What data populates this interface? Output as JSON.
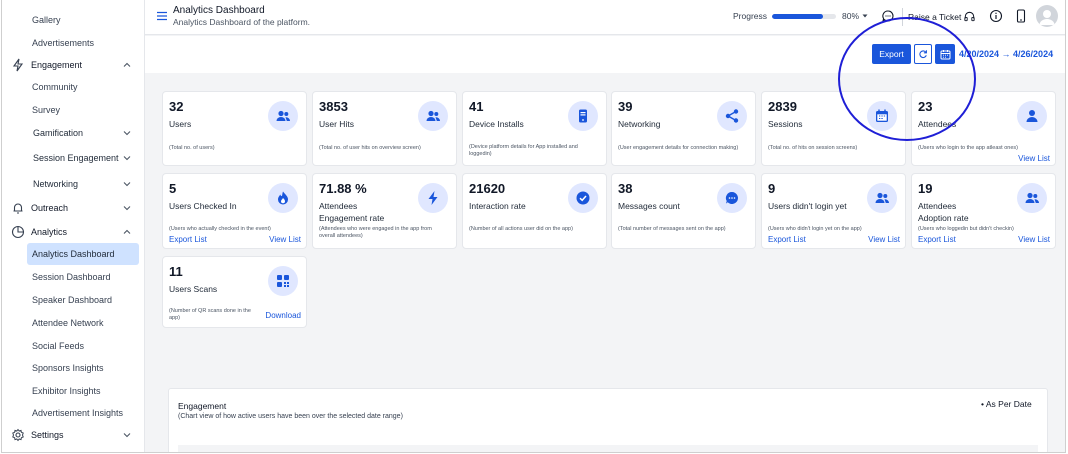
{
  "sidebar": {
    "items": [
      {
        "label": "Gallery",
        "kind": "sub"
      },
      {
        "label": "Advertisements",
        "kind": "sub"
      },
      {
        "label": "Engagement",
        "kind": "top",
        "icon": "lightning-icon",
        "chevron": "up"
      },
      {
        "label": "Community",
        "kind": "sub"
      },
      {
        "label": "Survey",
        "kind": "sub"
      },
      {
        "label": "Gamification",
        "kind": "group",
        "chevron": "down"
      },
      {
        "label": "Session Engagement",
        "kind": "group",
        "chevron": "down"
      },
      {
        "label": "Networking",
        "kind": "group",
        "chevron": "down"
      },
      {
        "label": "Outreach",
        "kind": "top",
        "icon": "bell-icon",
        "chevron": "down"
      },
      {
        "label": "Analytics",
        "kind": "top",
        "icon": "pie-chart-icon",
        "chevron": "up"
      },
      {
        "label": "Analytics Dashboard",
        "kind": "active"
      },
      {
        "label": "Session Dashboard",
        "kind": "sub"
      },
      {
        "label": "Speaker Dashboard",
        "kind": "sub"
      },
      {
        "label": "Attendee Network",
        "kind": "sub"
      },
      {
        "label": "Social Feeds",
        "kind": "sub"
      },
      {
        "label": "Sponsors Insights",
        "kind": "sub"
      },
      {
        "label": "Exhibitor Insights",
        "kind": "sub"
      },
      {
        "label": "Advertisement Insights",
        "kind": "sub"
      },
      {
        "label": "Settings",
        "kind": "top",
        "icon": "gear-icon",
        "chevron": "down"
      }
    ]
  },
  "header": {
    "title": "Analytics Dashboard",
    "subtitle": "Analytics Dashboard of the platform.",
    "progress_label": "Progress",
    "progress_value": 0.8,
    "progress_text": "80%",
    "raise_ticket": "Raise a Ticket"
  },
  "toolbar": {
    "export_label": "Export",
    "date_range": "4/20/2024 → 4/26/2024"
  },
  "cards": [
    {
      "value": "32",
      "label": "Users",
      "desc": "(Total no. of users)",
      "icon": "users-icon"
    },
    {
      "value": "3853",
      "label": "User Hits",
      "desc": "(Total no. of user hits on overview screen)",
      "icon": "users-icon"
    },
    {
      "value": "41",
      "label": "Device Installs",
      "desc": "(Device platform details for App installed and loggedin)",
      "icon": "phone-icon"
    },
    {
      "value": "39",
      "label": "Networking",
      "desc": "(User engagement details for connection making)",
      "icon": "share-icon"
    },
    {
      "value": "2839",
      "label": "Sessions",
      "desc": "(Total no. of hits on session screens)",
      "icon": "calendar-icon"
    },
    {
      "value": "23",
      "label": "Attendees",
      "desc": "(Users who login to the app atleast ones)",
      "icon": "user-icon",
      "link_right": "View List"
    },
    {
      "value": "5",
      "label": "Users Checked In",
      "desc": "(Users who actually checked in the event)",
      "icon": "flame-icon",
      "link_left": "Export List",
      "link_right": "View List"
    },
    {
      "value": "71.88 %",
      "label": "Attendees Engagement rate",
      "desc": "(Attendees who were engaged in the app from overall attendees)",
      "icon": "bolt-icon"
    },
    {
      "value": "21620",
      "label": "Interaction rate",
      "desc": "(Number of all actions user did on the app)",
      "icon": "check-icon"
    },
    {
      "value": "38",
      "label": "Messages count",
      "desc": "(Total number of messages sent on the app)",
      "icon": "message-icon"
    },
    {
      "value": "9",
      "label": "Users didn't login yet",
      "desc": "(Users who didn't login yet on the app)",
      "icon": "users-icon",
      "link_left": "Export List",
      "link_right": "View List"
    },
    {
      "value": "19",
      "label": "Attendees Adoption rate",
      "desc": "(Users who loggedin but didn't checkin)",
      "icon": "users-icon",
      "link_left": "Export List",
      "link_right": "View List"
    },
    {
      "value": "11",
      "label": "Users Scans",
      "desc": "(Number of QR scans done in the app)",
      "icon": "qr-icon",
      "link_right": "Download"
    }
  ],
  "engagement": {
    "title": "Engagement",
    "subtitle": "(Chart view of how active users have been over the selected date range)",
    "legend": "As Per Date"
  },
  "colors": {
    "accent": "#1a56db",
    "icon_bg": "#e0e7ff",
    "active_bg": "#cfe2ff"
  }
}
